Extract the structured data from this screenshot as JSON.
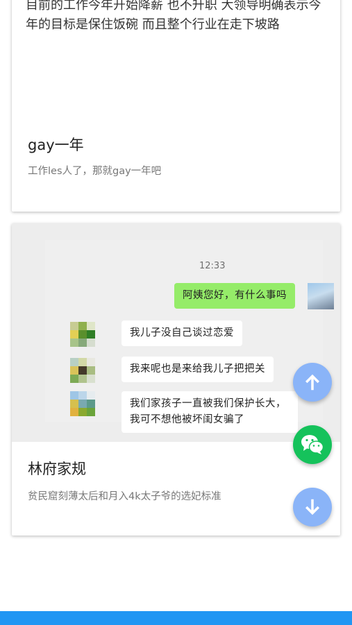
{
  "cards": [
    {
      "text": "目前的工作今年开始降薪 也不升职 大领导明确表示今年的目标是保住饭碗 而且整个行业在走下坡路",
      "title": "gay一年",
      "description": "工作les人了，那就gay一年吧"
    },
    {
      "title": "林府家规",
      "description": "贫民窟刻薄太后和月入4k太子爷的选妃标准",
      "image": {
        "time": "12:33",
        "messages": [
          {
            "side": "right",
            "text": "阿姨您好，有什么事吗"
          },
          {
            "side": "left",
            "text": "我儿子没自己谈过恋爱"
          },
          {
            "side": "left",
            "text": "我来呢也是来给我儿子把把关"
          },
          {
            "side": "left",
            "text": "我们家孩子一直被我们保护长大，我可不想他被坏闺女骗了"
          }
        ]
      }
    }
  ],
  "floating_buttons": [
    {
      "icon": "arrow-up-icon",
      "color": "#8ab4f8"
    },
    {
      "icon": "wechat-icon",
      "color": "#15c25b"
    },
    {
      "icon": "arrow-down-icon",
      "color": "#8ab4f8"
    }
  ],
  "bottom_bar_color": "#2196f3"
}
